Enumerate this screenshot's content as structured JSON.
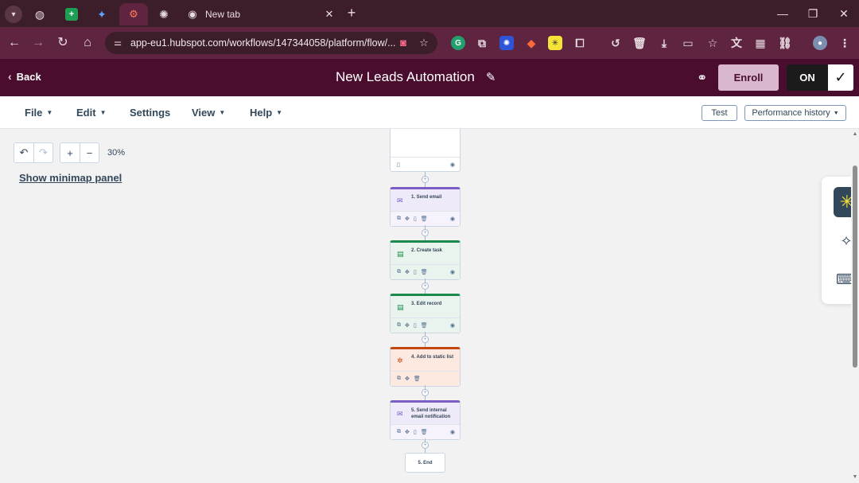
{
  "browser": {
    "tab_active_title": "New tab",
    "url": "app-eu1.hubspot.com/workflows/147344058/platform/flow/...",
    "colors": {
      "tabstrip": "#3c1e2a",
      "toolbar": "#5f2540"
    }
  },
  "header": {
    "back_label": "Back",
    "title": "New Leads Automation",
    "enroll_label": "Enroll",
    "on_label": "ON"
  },
  "menu": {
    "file": "File",
    "edit": "Edit",
    "settings": "Settings",
    "view": "View",
    "help": "Help",
    "test": "Test",
    "performance": "Performance history"
  },
  "canvas": {
    "zoom": "30%",
    "minimap_link": "Show minimap panel",
    "actions": [
      {
        "label": "1. Send email",
        "type": "email"
      },
      {
        "label": "2. Create task",
        "type": "task"
      },
      {
        "label": "3. Edit record",
        "type": "task"
      },
      {
        "label": "4. Add to static list",
        "type": "list"
      },
      {
        "label": "5. Send internal email notification",
        "type": "email"
      }
    ],
    "end_label": "5. End"
  },
  "icons": {
    "rail": [
      "breeze-icon",
      "sparkle-icon",
      "chat-icon"
    ]
  }
}
